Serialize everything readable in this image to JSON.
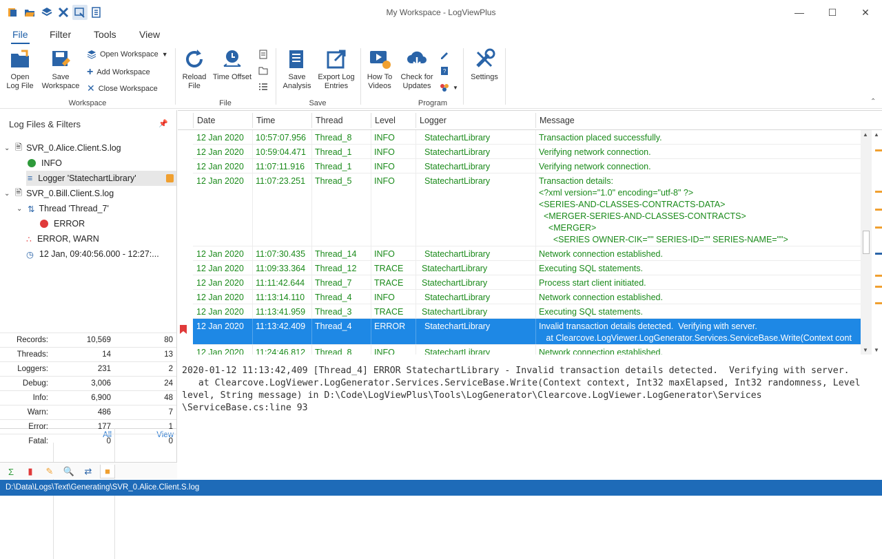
{
  "window": {
    "title": "My Workspace - LogViewPlus"
  },
  "quick_access": [
    "app-logo-icon",
    "open-folder-icon",
    "layers-icon",
    "tools-icon",
    "workspace-icon",
    "notes-icon"
  ],
  "menu_tabs": [
    "File",
    "Filter",
    "Tools",
    "View"
  ],
  "ribbon": {
    "open_log_file": "Open\nLog File",
    "save_workspace": "Save\nWorkspace",
    "open_workspace": "Open Workspace",
    "add_workspace": "Add Workspace",
    "close_workspace": "Close Workspace",
    "group_workspace": "Workspace",
    "reload_file": "Reload\nFile",
    "time_offset": "Time Offset",
    "group_file": "File",
    "save_analysis": "Save\nAnalysis",
    "export_log_entries": "Export Log\nEntries",
    "group_save": "Save",
    "how_to_videos": "How To\nVideos",
    "check_for_updates": "Check for\nUpdates",
    "settings": "Settings",
    "group_program": "Program"
  },
  "left_panel": {
    "title": "Log Files & Filters",
    "tree": [
      {
        "label": "SVR_0.Alice.Client.S.log"
      },
      {
        "label": "INFO"
      },
      {
        "label": "Logger 'StatechartLibrary'"
      },
      {
        "label": "SVR_0.Bill.Client.S.log"
      },
      {
        "label": "Thread 'Thread_7'"
      },
      {
        "label": "ERROR"
      },
      {
        "label": "ERROR, WARN"
      },
      {
        "label": "12 Jan, 09:40:56.000 - 12:27:..."
      }
    ],
    "stats_headers": {
      "all": "All",
      "view": "View"
    },
    "stats": [
      {
        "label": "Records:",
        "all": "10,569",
        "view": "80"
      },
      {
        "label": "Threads:",
        "all": "14",
        "view": "13"
      },
      {
        "label": "Loggers:",
        "all": "231",
        "view": "2"
      },
      {
        "label": "Debug:",
        "all": "3,006",
        "view": "24"
      },
      {
        "label": "Info:",
        "all": "6,900",
        "view": "48"
      },
      {
        "label": "Warn:",
        "all": "486",
        "view": "7"
      },
      {
        "label": "Error:",
        "all": "177",
        "view": "1"
      },
      {
        "label": "Fatal:",
        "all": "0",
        "view": "0"
      }
    ]
  },
  "grid": {
    "columns": [
      "Date",
      "Time",
      "Thread",
      "Level",
      "Logger",
      "Message"
    ],
    "rows": [
      {
        "date": "12 Jan 2020",
        "time": "10:57:07.956",
        "thread": "Thread_8",
        "level": "INFO",
        "logger": "StatechartLibrary",
        "message": "Transaction placed successfully."
      },
      {
        "date": "12 Jan 2020",
        "time": "10:59:04.471",
        "thread": "Thread_1",
        "level": "INFO",
        "logger": "StatechartLibrary",
        "message": "Verifying network connection."
      },
      {
        "date": "12 Jan 2020",
        "time": "11:07:11.916",
        "thread": "Thread_1",
        "level": "INFO",
        "logger": "StatechartLibrary",
        "message": "Verifying network connection."
      },
      {
        "date": "12 Jan 2020",
        "time": "11:07:23.251",
        "thread": "Thread_5",
        "level": "INFO",
        "logger": "StatechartLibrary",
        "message": "Transaction details:\n<?xml version=\"1.0\" encoding=\"utf-8\" ?>\n<SERIES-AND-CLASSES-CONTRACTS-DATA>\n  <MERGER-SERIES-AND-CLASSES-CONTRACTS>\n    <MERGER>\n      <SERIES OWNER-CIK=\"\" SERIES-ID=\"\" SERIES-NAME=\"\">"
      },
      {
        "date": "12 Jan 2020",
        "time": "11:07:30.435",
        "thread": "Thread_14",
        "level": "INFO",
        "logger": "StatechartLibrary",
        "message": "Network connection established."
      },
      {
        "date": "12 Jan 2020",
        "time": "11:09:33.364",
        "thread": "Thread_12",
        "level": "TRACE",
        "logger": "StatechartLibrary",
        "message": "Executing SQL statements."
      },
      {
        "date": "12 Jan 2020",
        "time": "11:11:42.644",
        "thread": "Thread_7",
        "level": "TRACE",
        "logger": "StatechartLibrary",
        "message": "Process start client initiated."
      },
      {
        "date": "12 Jan 2020",
        "time": "11:13:14.110",
        "thread": "Thread_4",
        "level": "INFO",
        "logger": "StatechartLibrary",
        "message": "Network connection established."
      },
      {
        "date": "12 Jan 2020",
        "time": "11:13:41.959",
        "thread": "Thread_3",
        "level": "TRACE",
        "logger": "StatechartLibrary",
        "message": "Executing SQL statements."
      },
      {
        "date": "12 Jan 2020",
        "time": "11:13:42.409",
        "thread": "Thread_4",
        "level": "ERROR",
        "logger": "StatechartLibrary",
        "message": "Invalid transaction details detected.  Verifying with server.\n   at Clearcove.LogViewer.LogGenerator.Services.ServiceBase.Write(Context cont"
      },
      {
        "date": "12 Jan 2020",
        "time": "11:24:46.812",
        "thread": "Thread_8",
        "level": "INFO",
        "logger": "StatechartLibrary",
        "message": "Network connection established."
      }
    ]
  },
  "detail": {
    "header": "2020-01-12 11:13:42,409 [Thread_4] ERROR StatechartLibrary - Invalid transaction details detected.  Verifying with server.",
    "line2": "   at Clearcove.LogViewer.LogGenerator.Services.ServiceBase.Write(Context context, Int32 maxElapsed, Int32 randomness, Level",
    "line3": "level, String message) in D:\\Code\\LogViewPlus\\Tools\\LogGenerator\\Clearcove.LogViewer.LogGenerator\\Services",
    "line4": "\\ServiceBase.cs:line 93"
  },
  "status_bar": {
    "path": "D:\\Data\\Logs\\Text\\Generating\\SVR_0.Alice.Client.S.log"
  },
  "colors": {
    "accent": "#1e88e5",
    "status_bar": "#1e6bb8",
    "log_text": "#1a8a1a"
  }
}
